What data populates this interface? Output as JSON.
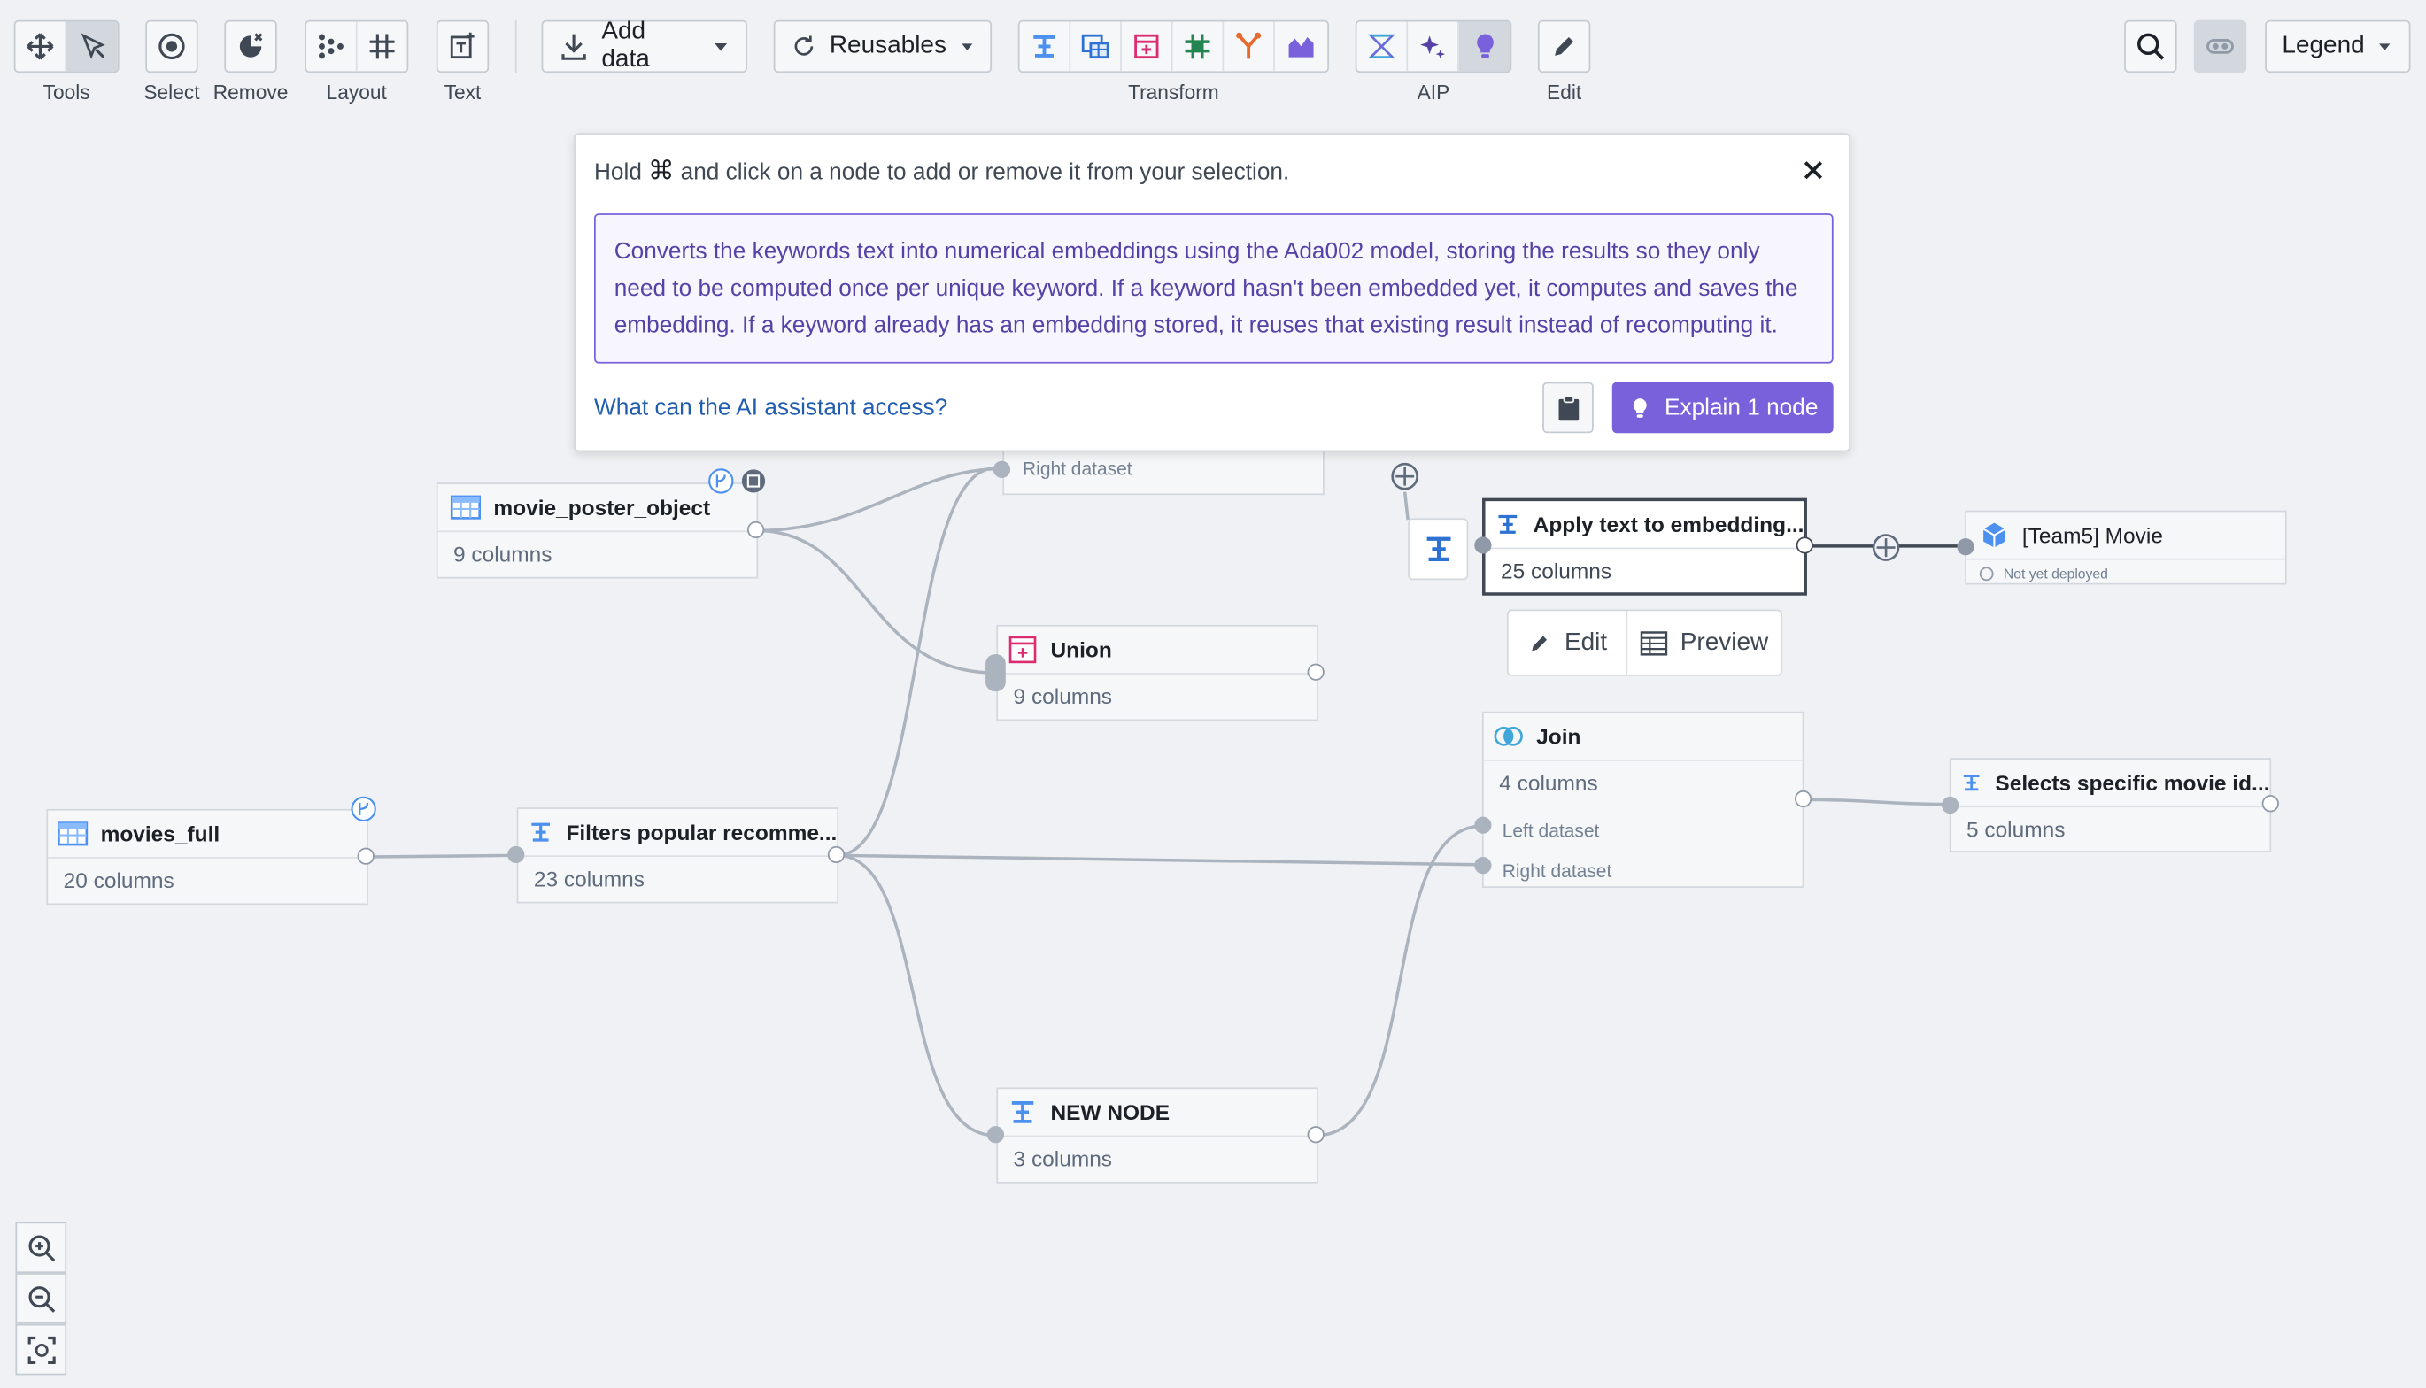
{
  "toolbar": {
    "labels": {
      "tools": "Tools",
      "select": "Select",
      "remove": "Remove",
      "layout": "Layout",
      "text": "Text",
      "transform": "Transform",
      "aip": "AIP",
      "edit": "Edit"
    },
    "add_data": "Add data",
    "reusables": "Reusables",
    "legend": "Legend"
  },
  "popover": {
    "hint_before": "Hold",
    "hint_key": "⌘",
    "hint_after": "and click on a node to add or remove it from your selection.",
    "description": "Converts the keywords text into numerical embeddings using the Ada002 model, storing the results so they only need to be computed once per unique keyword. If a keyword hasn't been embedded yet, it computes and saves the embedding. If a keyword already has an embedding stored, it reuses that existing result instead of recomputing it.",
    "ai_link": "What can the AI assistant access?",
    "explain_button": "Explain 1 node"
  },
  "nodes": {
    "hidden_join_port": "Right dataset",
    "movie_poster": {
      "title": "movie_poster_object",
      "sub": "9 columns"
    },
    "union": {
      "title": "Union",
      "sub": "9 columns"
    },
    "apply": {
      "title": "Apply text to embedding...",
      "sub": "25 columns"
    },
    "team5": {
      "title": "[Team5] Movie",
      "sub": "Not yet deployed"
    },
    "join": {
      "title": "Join",
      "sub": "4 columns",
      "left": "Left dataset",
      "right": "Right dataset"
    },
    "selects": {
      "title": "Selects specific movie id...",
      "sub": "5 columns"
    },
    "movies_full": {
      "title": "movies_full",
      "sub": "20 columns"
    },
    "filters": {
      "title": "Filters popular recomme...",
      "sub": "23 columns"
    },
    "new_node": {
      "title": "NEW NODE",
      "sub": "3 columns"
    }
  },
  "node_actions": {
    "edit": "Edit",
    "preview": "Preview"
  },
  "colors": {
    "accent_purple": "#7961db",
    "transform_blue": "#4c90f0",
    "union_pink": "#db2c6f",
    "link_blue": "#215db0"
  }
}
